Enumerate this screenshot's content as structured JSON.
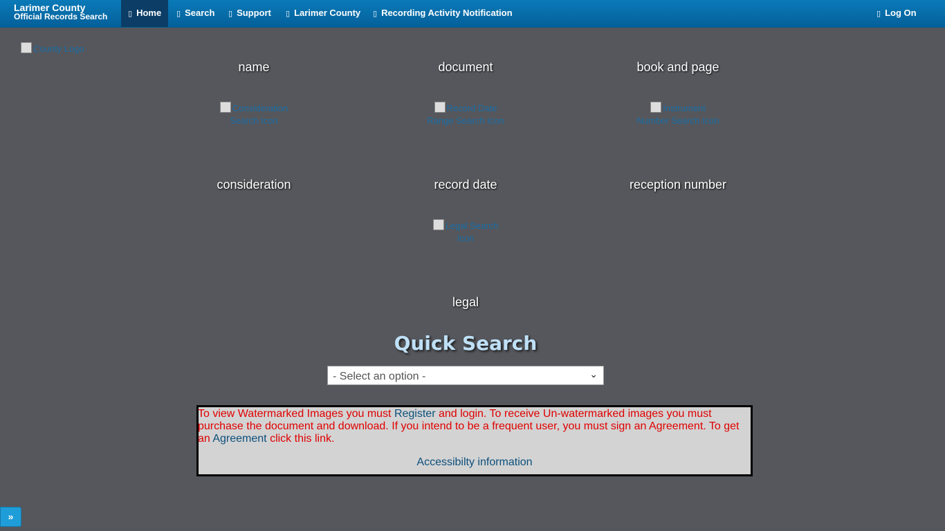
{
  "brand": {
    "line1": "Larimer County",
    "line2": "Official Records Search"
  },
  "nav": [
    {
      "icon": "home-icon",
      "glyph": "▯",
      "label": "Home",
      "active": true
    },
    {
      "icon": "search-icon",
      "glyph": "▯",
      "label": "Search"
    },
    {
      "icon": "support-icon",
      "glyph": "▯",
      "label": "Support"
    },
    {
      "icon": "building-icon",
      "glyph": "▯",
      "label": "Larimer County"
    },
    {
      "icon": "bell-icon",
      "glyph": "▯",
      "label": "Recording Activity Notification"
    }
  ],
  "login": {
    "icon": "login-icon",
    "glyph": "▯",
    "label": "Log On"
  },
  "logo_alt": "County Logo",
  "tiles": [
    {
      "label": "name"
    },
    {
      "label": "document"
    },
    {
      "label": "book and page"
    },
    {
      "icon_alt": "Consideration Search Icon",
      "label": "consideration"
    },
    {
      "icon_alt": "Record Date Range Search Icon",
      "label": "record date"
    },
    {
      "icon_alt": "Instrument Number Search Icon",
      "label": "reception number"
    },
    {
      "icon_alt": "Legal Search Icon",
      "label": "legal"
    }
  ],
  "quick_search": {
    "title": "Quick Search",
    "selected": "- Select an option -"
  },
  "notice": {
    "part1": "To view Watermarked Images you must ",
    "register_link": "Register",
    "part2": " and login. To receive Un-watermarked images you must purchase the document and download. If you intend to be a frequent user, you must sign an Agreement. To get an ",
    "agreement_link": "Agreement",
    "part3": " click this link.",
    "accessibility": "Accessibilty information"
  },
  "expander": "»",
  "colors": {
    "navbar": "#04609a",
    "background": "#55575c",
    "notice_text": "#e00000",
    "link": "#0b4f7c"
  }
}
